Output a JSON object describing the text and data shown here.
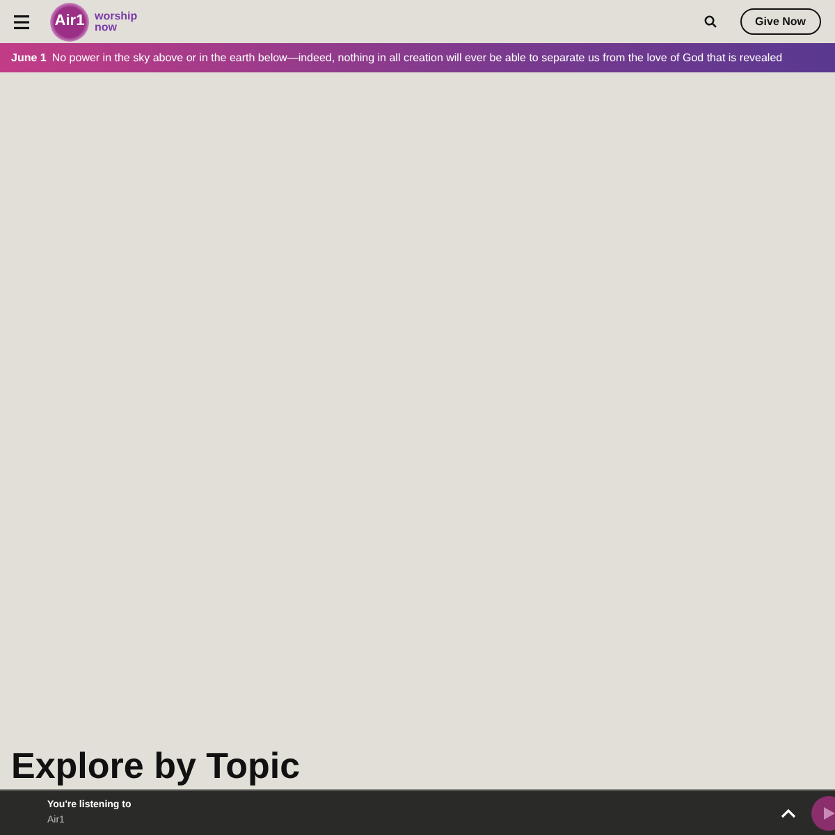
{
  "header": {
    "logo": {
      "mark": "Air1",
      "tagline_1": "worship",
      "tagline_2": "now"
    },
    "give_button": "Give Now"
  },
  "verse_banner": {
    "date": "June 1",
    "text": "No power in the sky above or in the earth below—indeed, nothing in all creation will ever be able to separate us from the love of God that is revealed"
  },
  "section_heading": "Explore by Topic",
  "player": {
    "label": "You're listening to",
    "station": "Air1",
    "playing": false
  }
}
